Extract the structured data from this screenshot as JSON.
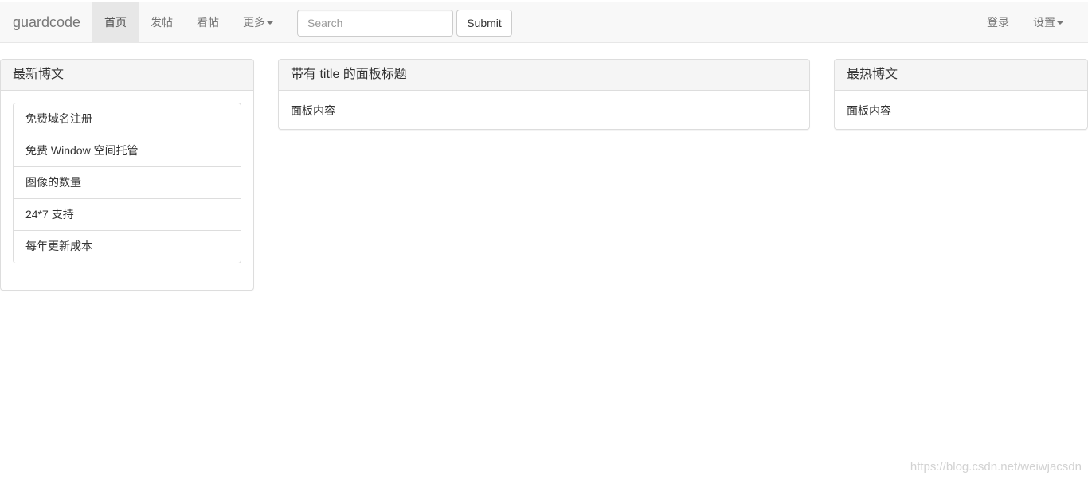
{
  "navbar": {
    "brand": "guardcode",
    "items": [
      {
        "label": "首页",
        "active": true
      },
      {
        "label": "发帖",
        "active": false
      },
      {
        "label": "看帖",
        "active": false
      },
      {
        "label": "更多",
        "dropdown": true
      }
    ],
    "search": {
      "placeholder": "Search",
      "value": ""
    },
    "submit_label": "Submit",
    "right": {
      "login_label": "登录",
      "settings_label": "设置"
    }
  },
  "left_panel": {
    "title": "最新博文",
    "items": [
      "免费域名注册",
      "免费 Window 空间托管",
      "图像的数量",
      "24*7 支持",
      "每年更新成本"
    ]
  },
  "center_panel": {
    "title": "带有 title 的面板标题",
    "body": "面板内容"
  },
  "right_panel": {
    "title": "最热博文",
    "body": "面板内容"
  },
  "watermark": "https://blog.csdn.net/weiwjacsdn",
  "colors": {
    "navbar_bg": "#f8f8f8",
    "active_nav_bg": "#e7e7e7",
    "panel_heading_bg": "#f5f5f5",
    "border": "#dddddd"
  }
}
